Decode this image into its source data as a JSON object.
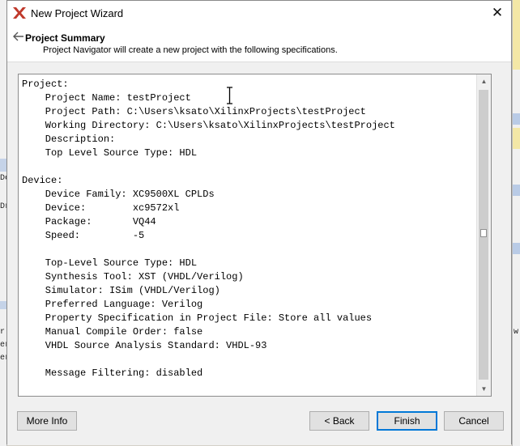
{
  "window": {
    "title": "New Project Wizard",
    "close_glyph": "✕"
  },
  "header": {
    "title": "Project Summary",
    "subtitle": "Project Navigator will create a new project with the following specifications."
  },
  "summary_lines": [
    "Project:",
    "    Project Name: testProject",
    "    Project Path: C:\\Users\\ksato\\XilinxProjects\\testProject",
    "    Working Directory: C:\\Users\\ksato\\XilinxProjects\\testProject",
    "    Description:",
    "    Top Level Source Type: HDL",
    "",
    "Device:",
    "    Device Family: XC9500XL CPLDs",
    "    Device:        xc9572xl",
    "    Package:       VQ44",
    "    Speed:         -5",
    "",
    "    Top-Level Source Type: HDL",
    "    Synthesis Tool: XST (VHDL/Verilog)",
    "    Simulator: ISim (VHDL/Verilog)",
    "    Preferred Language: Verilog",
    "    Property Specification in Project File: Store all values",
    "    Manual Compile Order: false",
    "    VHDL Source Analysis Standard: VHDL-93",
    "",
    "    Message Filtering: disabled"
  ],
  "buttons": {
    "more_info": "More Info",
    "back": "< Back",
    "finish": "Finish",
    "cancel": "Cancel"
  },
  "background_fragments": {
    "left_1": "De",
    "left_2": "Dr",
    "left_3": "r",
    "left_4": "er",
    "left_5": "er",
    "right_1": "w"
  },
  "colors": {
    "accent": "#0078d7",
    "logo": "#c0392b"
  }
}
